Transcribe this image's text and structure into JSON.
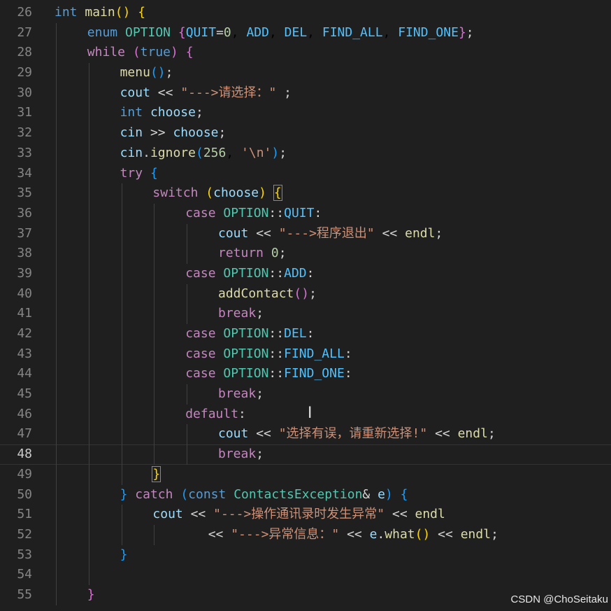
{
  "editor": {
    "lines": [
      {
        "n": "26",
        "indent": 0,
        "tokens": [
          [
            "int",
            "kw"
          ],
          [
            " ",
            ""
          ],
          [
            "main",
            "fn"
          ],
          [
            "(",
            "p1"
          ],
          [
            ")",
            "p1"
          ],
          [
            " ",
            ""
          ],
          [
            "{",
            "p1"
          ]
        ]
      },
      {
        "n": "27",
        "indent": 1,
        "tokens": [
          [
            "enum",
            "kw"
          ],
          [
            " ",
            ""
          ],
          [
            "OPTION",
            "ty"
          ],
          [
            " ",
            ""
          ],
          [
            "{",
            "p2"
          ],
          [
            "QUIT",
            "en"
          ],
          [
            "=",
            "op"
          ],
          [
            "0",
            "num"
          ],
          [
            ", ",
            ""
          ],
          [
            "ADD",
            "en"
          ],
          [
            ", ",
            ""
          ],
          [
            "DEL",
            "en"
          ],
          [
            ", ",
            ""
          ],
          [
            "FIND_ALL",
            "en"
          ],
          [
            ", ",
            ""
          ],
          [
            "FIND_ONE",
            "en"
          ],
          [
            "}",
            "p2"
          ],
          [
            ";",
            "op"
          ]
        ]
      },
      {
        "n": "28",
        "indent": 1,
        "tokens": [
          [
            "while",
            "ctl"
          ],
          [
            " ",
            ""
          ],
          [
            "(",
            "p2"
          ],
          [
            "true",
            "kw"
          ],
          [
            ")",
            "p2"
          ],
          [
            " ",
            ""
          ],
          [
            "{",
            "p2"
          ]
        ]
      },
      {
        "n": "29",
        "indent": 2,
        "tokens": [
          [
            "menu",
            "fn"
          ],
          [
            "(",
            "p3"
          ],
          [
            ")",
            "p3"
          ],
          [
            ";",
            "op"
          ]
        ]
      },
      {
        "n": "30",
        "indent": 2,
        "tokens": [
          [
            "cout",
            "var"
          ],
          [
            " << ",
            "op"
          ],
          [
            "\"--->请选择：\"",
            "str"
          ],
          [
            " ;",
            "op"
          ]
        ]
      },
      {
        "n": "31",
        "indent": 2,
        "tokens": [
          [
            "int",
            "kw"
          ],
          [
            " ",
            ""
          ],
          [
            "choose",
            "var"
          ],
          [
            ";",
            "op"
          ]
        ]
      },
      {
        "n": "32",
        "indent": 2,
        "tokens": [
          [
            "cin",
            "var"
          ],
          [
            " >> ",
            "op"
          ],
          [
            "choose",
            "var"
          ],
          [
            ";",
            "op"
          ]
        ]
      },
      {
        "n": "33",
        "indent": 2,
        "tokens": [
          [
            "cin",
            "var"
          ],
          [
            ".",
            "op"
          ],
          [
            "ignore",
            "fn"
          ],
          [
            "(",
            "p3"
          ],
          [
            "256",
            "num"
          ],
          [
            ", ",
            ""
          ],
          [
            "'\\n'",
            "str"
          ],
          [
            ")",
            "p3"
          ],
          [
            ";",
            "op"
          ]
        ]
      },
      {
        "n": "34",
        "indent": 2,
        "tokens": [
          [
            "try",
            "ctl"
          ],
          [
            " ",
            ""
          ],
          [
            "{",
            "p3"
          ]
        ]
      },
      {
        "n": "35",
        "indent": 3,
        "tokens": [
          [
            "switch",
            "ctl"
          ],
          [
            " ",
            ""
          ],
          [
            "(",
            "p1"
          ],
          [
            "choose",
            "var"
          ],
          [
            ")",
            "p1"
          ],
          [
            " ",
            ""
          ],
          [
            "{",
            "p1b"
          ]
        ]
      },
      {
        "n": "36",
        "indent": 4,
        "tokens": [
          [
            "case",
            "ctl"
          ],
          [
            " ",
            ""
          ],
          [
            "OPTION",
            "ty"
          ],
          [
            "::",
            "op"
          ],
          [
            "QUIT",
            "en"
          ],
          [
            ":",
            "op"
          ]
        ]
      },
      {
        "n": "37",
        "indent": 5,
        "tokens": [
          [
            "cout",
            "var"
          ],
          [
            " << ",
            "op"
          ],
          [
            "\"--->程序退出\"",
            "str"
          ],
          [
            " << ",
            "op"
          ],
          [
            "endl",
            "fn"
          ],
          [
            ";",
            "op"
          ]
        ]
      },
      {
        "n": "38",
        "indent": 5,
        "tokens": [
          [
            "return",
            "ctl"
          ],
          [
            " ",
            ""
          ],
          [
            "0",
            "num"
          ],
          [
            ";",
            "op"
          ]
        ]
      },
      {
        "n": "39",
        "indent": 4,
        "tokens": [
          [
            "case",
            "ctl"
          ],
          [
            " ",
            ""
          ],
          [
            "OPTION",
            "ty"
          ],
          [
            "::",
            "op"
          ],
          [
            "ADD",
            "en"
          ],
          [
            ":",
            "op"
          ]
        ]
      },
      {
        "n": "40",
        "indent": 5,
        "tokens": [
          [
            "addContact",
            "fn"
          ],
          [
            "(",
            "p2"
          ],
          [
            ")",
            "p2"
          ],
          [
            ";",
            "op"
          ]
        ]
      },
      {
        "n": "41",
        "indent": 5,
        "tokens": [
          [
            "break",
            "ctl"
          ],
          [
            ";",
            "op"
          ]
        ]
      },
      {
        "n": "42",
        "indent": 4,
        "tokens": [
          [
            "case",
            "ctl"
          ],
          [
            " ",
            ""
          ],
          [
            "OPTION",
            "ty"
          ],
          [
            "::",
            "op"
          ],
          [
            "DEL",
            "en"
          ],
          [
            ":",
            "op"
          ]
        ]
      },
      {
        "n": "43",
        "indent": 4,
        "tokens": [
          [
            "case",
            "ctl"
          ],
          [
            " ",
            ""
          ],
          [
            "OPTION",
            "ty"
          ],
          [
            "::",
            "op"
          ],
          [
            "FIND_ALL",
            "en"
          ],
          [
            ":",
            "op"
          ]
        ]
      },
      {
        "n": "44",
        "indent": 4,
        "tokens": [
          [
            "case",
            "ctl"
          ],
          [
            " ",
            ""
          ],
          [
            "OPTION",
            "ty"
          ],
          [
            "::",
            "op"
          ],
          [
            "FIND_ONE",
            "en"
          ],
          [
            ":",
            "op"
          ]
        ]
      },
      {
        "n": "45",
        "indent": 5,
        "tokens": [
          [
            "break",
            "ctl"
          ],
          [
            ";",
            "op"
          ]
        ]
      },
      {
        "n": "46",
        "indent": 4,
        "tokens": [
          [
            "default",
            "ctl"
          ],
          [
            ":",
            "op"
          ]
        ]
      },
      {
        "n": "47",
        "indent": 5,
        "tokens": [
          [
            "cout",
            "var"
          ],
          [
            " << ",
            "op"
          ],
          [
            "\"选择有误，请重新选择!\"",
            "str"
          ],
          [
            " << ",
            "op"
          ],
          [
            "endl",
            "fn"
          ],
          [
            ";",
            "op"
          ]
        ]
      },
      {
        "n": "48",
        "indent": 5,
        "current": true,
        "tokens": [
          [
            "break",
            "ctl"
          ],
          [
            ";",
            "op"
          ]
        ]
      },
      {
        "n": "49",
        "indent": 3,
        "tokens": [
          [
            "}",
            "p1b"
          ]
        ]
      },
      {
        "n": "50",
        "indent": 2,
        "tokens": [
          [
            "}",
            "p3"
          ],
          [
            " ",
            ""
          ],
          [
            "catch",
            "ctl"
          ],
          [
            " ",
            ""
          ],
          [
            "(",
            "p3"
          ],
          [
            "const",
            "kw"
          ],
          [
            " ",
            ""
          ],
          [
            "ContactsException",
            "ty"
          ],
          [
            "&",
            "op"
          ],
          [
            " ",
            ""
          ],
          [
            "e",
            "var"
          ],
          [
            ")",
            "p3"
          ],
          [
            " ",
            ""
          ],
          [
            "{",
            "p3"
          ]
        ]
      },
      {
        "n": "51",
        "indent": 3,
        "tokens": [
          [
            "cout",
            "var"
          ],
          [
            " << ",
            "op"
          ],
          [
            "\"--->操作通讯录时发生异常\"",
            "str"
          ],
          [
            " << ",
            "op"
          ],
          [
            "endl",
            "fn"
          ]
        ]
      },
      {
        "n": "52",
        "indent": 4,
        "prefix": "   ",
        "tokens": [
          [
            "<< ",
            "op"
          ],
          [
            "\"--->异常信息：\"",
            "str"
          ],
          [
            " << ",
            "op"
          ],
          [
            "e",
            "var"
          ],
          [
            ".",
            "op"
          ],
          [
            "what",
            "fn"
          ],
          [
            "(",
            "p1"
          ],
          [
            ")",
            "p1"
          ],
          [
            " << ",
            "op"
          ],
          [
            "endl",
            "fn"
          ],
          [
            ";",
            "op"
          ]
        ]
      },
      {
        "n": "53",
        "indent": 2,
        "tokens": [
          [
            "}",
            "p3"
          ]
        ]
      },
      {
        "n": "54",
        "indent": 2,
        "guidesOnly": true,
        "tokens": []
      },
      {
        "n": "55",
        "indent": 1,
        "tokens": [
          [
            "}",
            "p2"
          ]
        ]
      }
    ]
  },
  "watermark": "CSDN @ChoSeitaku",
  "cursor_glyph": "I",
  "colors": {
    "background": "#1f1f1f",
    "keyword": "#569cd6",
    "control": "#c586c0",
    "function": "#dcdcaa",
    "type": "#4ec9b0",
    "enum_member": "#4fc1ff",
    "variable": "#9cdcfe",
    "string": "#ce9178",
    "number": "#b5cea8"
  }
}
